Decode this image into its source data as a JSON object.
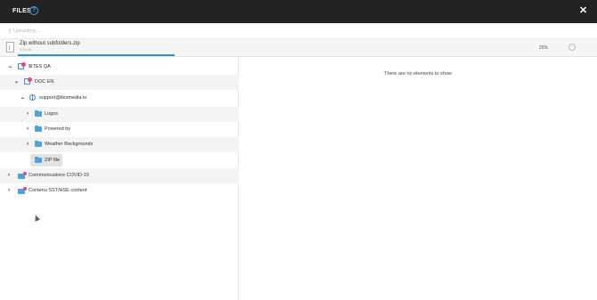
{
  "header": {
    "title": "FILES",
    "help_icon": "question-circle-icon",
    "close_icon": "close-icon",
    "close_glyph": "✕"
  },
  "upload": {
    "label": "Uploading...",
    "icon": "upload-icon",
    "icon_glyph": "⇧"
  },
  "file": {
    "name": "Zip without subfolders.zip",
    "size": "0.00 kB",
    "progress_percent": 29,
    "progress_label": "29%",
    "progress_color": "#2a8fd6",
    "cancel_icon": "cancel-circle-icon"
  },
  "tree": [
    {
      "label": "$ITES QA",
      "chevron": "⌄",
      "icon": "site-icon"
    },
    {
      "label": "DOC EN",
      "chevron": "⌄",
      "icon": "site-icon"
    },
    {
      "label": "support@itesmedia.tv",
      "chevron": "⌄",
      "icon": "globe-icon"
    },
    {
      "label": "Logos",
      "chevron": "›",
      "icon": "folder-icon"
    },
    {
      "label": "Powered by",
      "chevron": "›",
      "icon": "folder-icon"
    },
    {
      "label": "Weather Backgrounds",
      "chevron": "›",
      "icon": "folder-icon"
    },
    {
      "label": "ZIP file",
      "chevron": "",
      "icon": "folder-icon"
    },
    {
      "label": "Communications COVID-19",
      "chevron": "›",
      "icon": "shared-folder-icon"
    },
    {
      "label": "Contenu SST/HSE content",
      "chevron": "›",
      "icon": "shared-folder-icon"
    }
  ],
  "right_pane": {
    "empty_message": "There are no elements to show"
  },
  "colors": {
    "header_bg": "#232323",
    "accent": "#2a8fd6",
    "folder": "#4ea3df",
    "site_dot": "#e2497a"
  }
}
